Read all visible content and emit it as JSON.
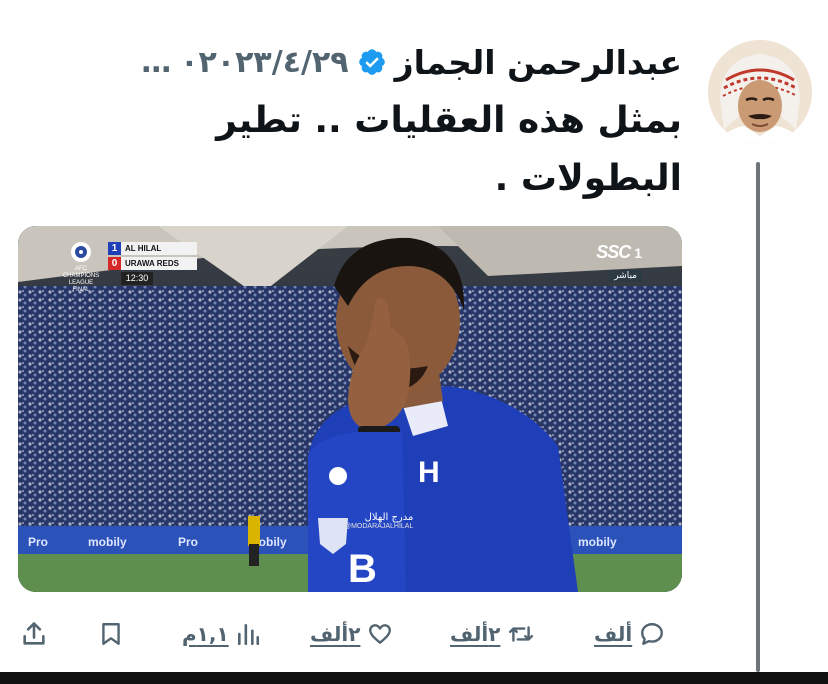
{
  "tweet": {
    "author_name": "عبدالرحمن الجماز",
    "date": "٢٠٢٣/٤/٢٩",
    "date_prefix": "٠",
    "more": "…",
    "text": "بمثل هذه العقليات .. تطير البطولات ."
  },
  "media": {
    "competition_label": "AFC CHAMPIONS LEAGUE FINAL",
    "scoreboard": {
      "home_team": "AL HILAL",
      "home_score": "1",
      "away_team": "URAWA REDS",
      "away_score": "0",
      "clock": "12:30"
    },
    "broadcaster": {
      "logo": "SSC",
      "channel": "1",
      "live": "مباشر"
    },
    "watermark": {
      "name": "مدرج الهلال",
      "handle": "@MODARAJALHILAL"
    }
  },
  "actions": {
    "replies": "ألف",
    "reposts": "٢ألف",
    "likes": "٢ألف",
    "views": "١,١م"
  },
  "icons": {
    "reply": "reply-icon",
    "repost": "repost-icon",
    "like": "heart-icon",
    "views": "views-icon",
    "bookmark": "bookmark-icon",
    "share": "share-icon",
    "verified": "verified-badge-icon"
  },
  "colors": {
    "verified": "#1d9bf0",
    "secondary_text": "#536471",
    "jersey": "#1f3fb8"
  }
}
